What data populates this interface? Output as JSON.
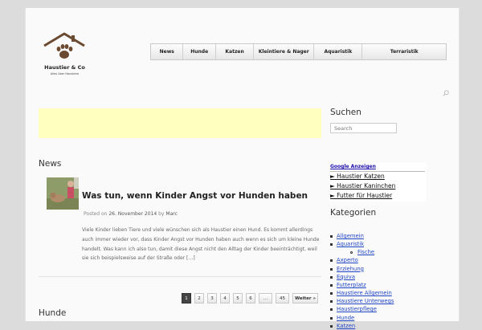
{
  "logo": {
    "title": "Haustier & Co",
    "subtitle": "Alles über Haustiere"
  },
  "nav": [
    {
      "label": "News",
      "width": 40
    },
    {
      "label": "Hunde",
      "width": 40
    },
    {
      "label": "Katzen",
      "width": 47
    },
    {
      "label": "Kleintiere & Nager",
      "width": 75
    },
    {
      "label": "Aquaristik",
      "width": 60
    },
    {
      "label": "Terraristik",
      "width": 105
    }
  ],
  "main": {
    "section_news": "News",
    "section_hunde": "Hunde",
    "post": {
      "title": "Was tun, wenn Kinder Angst vor Hunden haben",
      "posted_label": "Posted on",
      "date": "26. November 2014",
      "by_label": "by",
      "author": "Marc",
      "excerpt": "Viele Kinder lieben Tiere und viele wünschen sich als Haustier einen Hund. Es kommt allerdings auch immer wieder vor, dass Kinder Angst vor Hunden haben auch wenn es sich um kleine Hunde handelt. Was kann ich also tun, damit diese Angst nicht den Alltag der Kinder beeinträchtigt, weil sie sich beispielsweise auf der Straße oder […]"
    },
    "pagination": [
      "1",
      "2",
      "3",
      "4",
      "5",
      "6",
      "…",
      "45",
      "Weiter »"
    ]
  },
  "sidebar": {
    "search_title": "Suchen",
    "search_placeholder": "Search",
    "ads_header": "Google Anzeigen",
    "ads": [
      "► Haustier Katzen",
      "► Haustier Kaninchen",
      "► Futter für Haustier"
    ],
    "categories_title": "Kategorien",
    "categories": [
      {
        "label": "Allgemein",
        "sub": false
      },
      {
        "label": "Aquaristik",
        "sub": false
      },
      {
        "label": "Fische",
        "sub": true
      },
      {
        "label": "Axperto",
        "sub": false
      },
      {
        "label": "Erziehung",
        "sub": false
      },
      {
        "label": "Equiva",
        "sub": false
      },
      {
        "label": "Futterplatz",
        "sub": false
      },
      {
        "label": "Haustiere Allgemein",
        "sub": false
      },
      {
        "label": "Haustiere Unterwegs",
        "sub": false
      },
      {
        "label": "Haustierpflege",
        "sub": false
      },
      {
        "label": "Hunde",
        "sub": false
      },
      {
        "label": "Katzen",
        "sub": false
      }
    ]
  },
  "colors": {
    "ad_bg": "#ffffbf",
    "link": "#1f45c4",
    "page_bg": "#fafafa"
  },
  "icons": {
    "search": "search-icon"
  }
}
